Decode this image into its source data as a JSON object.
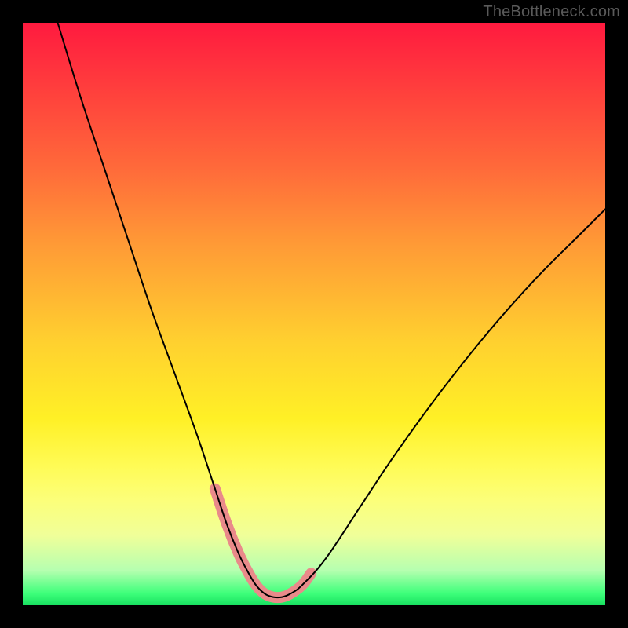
{
  "watermark": "TheBottleneck.com",
  "chart_data": {
    "type": "line",
    "title": "",
    "xlabel": "",
    "ylabel": "",
    "xlim": [
      0,
      100
    ],
    "ylim": [
      0,
      100
    ],
    "series": [
      {
        "name": "bottleneck-curve",
        "color": "#000000",
        "stroke_width": 2,
        "x": [
          6,
          10,
          14,
          18,
          22,
          26,
          30,
          33,
          35,
          37,
          38.5,
          40,
          41.5,
          43,
          44.5,
          46,
          48,
          52,
          58,
          64,
          72,
          80,
          88,
          96,
          100
        ],
        "y": [
          100,
          87,
          75,
          63,
          51,
          40,
          29,
          20,
          14,
          9,
          6,
          3.5,
          2,
          1.4,
          1.4,
          2,
          3.5,
          8,
          17,
          26,
          37,
          47,
          56,
          64,
          68
        ]
      },
      {
        "name": "highlight-segment",
        "color": "#e98a8a",
        "stroke_width": 14,
        "x": [
          33,
          35,
          37,
          38.5,
          40,
          41.5,
          43,
          44.5,
          46,
          48,
          49.5
        ],
        "y": [
          20,
          14,
          9,
          6,
          3.5,
          2,
          1.4,
          1.4,
          2,
          3.5,
          5.5
        ]
      }
    ],
    "annotations": []
  }
}
